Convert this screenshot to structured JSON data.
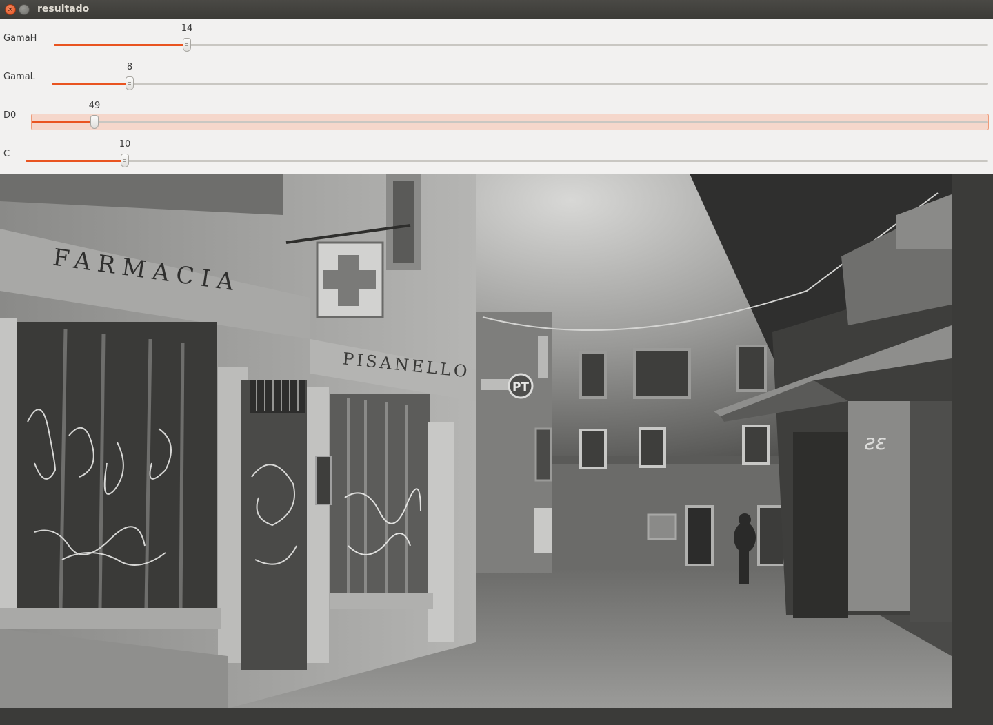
{
  "window": {
    "title": "resultado",
    "close_icon": "close-icon",
    "minimize_icon": "minimize-icon"
  },
  "trackbars": [
    {
      "label": "GamaH",
      "value": "14",
      "fraction": 0.142
    },
    {
      "label": "GamaL",
      "value": "8",
      "fraction": 0.083
    },
    {
      "label": "D0",
      "value": "49",
      "fraction": 0.065,
      "focused": true
    },
    {
      "label": "C",
      "value": "10",
      "fraction": 0.103
    }
  ],
  "image": {
    "signs": {
      "farmacia": "FARMACIA",
      "pisanello": "PISANELLO",
      "pt": "PT"
    }
  },
  "colors": {
    "accent": "#e95420",
    "titlebar": "#3c3b37",
    "panel": "#f2f1f0",
    "background": "#3b3b39"
  }
}
